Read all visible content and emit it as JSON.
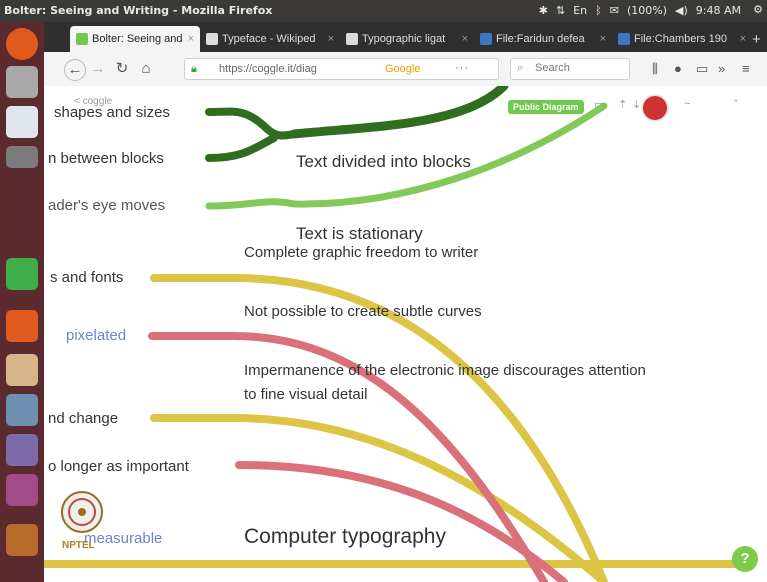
{
  "window": {
    "title": "Bolter: Seeing and Writing - Mozilla Firefox",
    "status": {
      "battery": "(100%)",
      "time": "9:48 AM",
      "keyboard": "En"
    }
  },
  "tabs": [
    {
      "label": "Bolter: Seeing and",
      "favicon": "coggle-icon",
      "color": "#6ec94f",
      "active": true
    },
    {
      "label": "Typeface - Wikiped",
      "favicon": "wikipedia-icon",
      "color": "#dcdcdc",
      "active": false
    },
    {
      "label": "Typographic ligat",
      "favicon": "wikipedia-icon",
      "color": "#dcdcdc",
      "active": false
    },
    {
      "label": "File:Faridun defea",
      "favicon": "wikimedia-icon",
      "color": "#3a78c2",
      "active": false
    },
    {
      "label": "File:Chambers 190",
      "favicon": "wikimedia-icon",
      "color": "#3a78c2",
      "active": false
    }
  ],
  "navbar": {
    "url": "https://coggle.it/diag",
    "search_engine": "Google",
    "search_placeholder": "Search",
    "more": "···"
  },
  "diagram": {
    "back_link": "< coggle",
    "public_badge": "Public Diagram",
    "colors": {
      "dark_green": "#2f6e1f",
      "light_green": "#82c95a",
      "yellow": "#dcc545",
      "red": "#d9707a",
      "link": "#6b86c9"
    },
    "left_nodes": [
      "shapes and sizes",
      "n between blocks",
      "ader's eye moves",
      "s and fonts",
      "pixelated",
      "nd change",
      "o longer as important",
      "measurable"
    ],
    "right_nodes": [
      "Text divided into blocks",
      "Text is stationary",
      "Complete graphic freedom to writer",
      "Not possible to create subtle curves",
      "Impermanence of the electronic image discourages attention",
      "to fine visual detail",
      "Computer typography"
    ],
    "help": "?",
    "logo_text": "NPTEL"
  }
}
